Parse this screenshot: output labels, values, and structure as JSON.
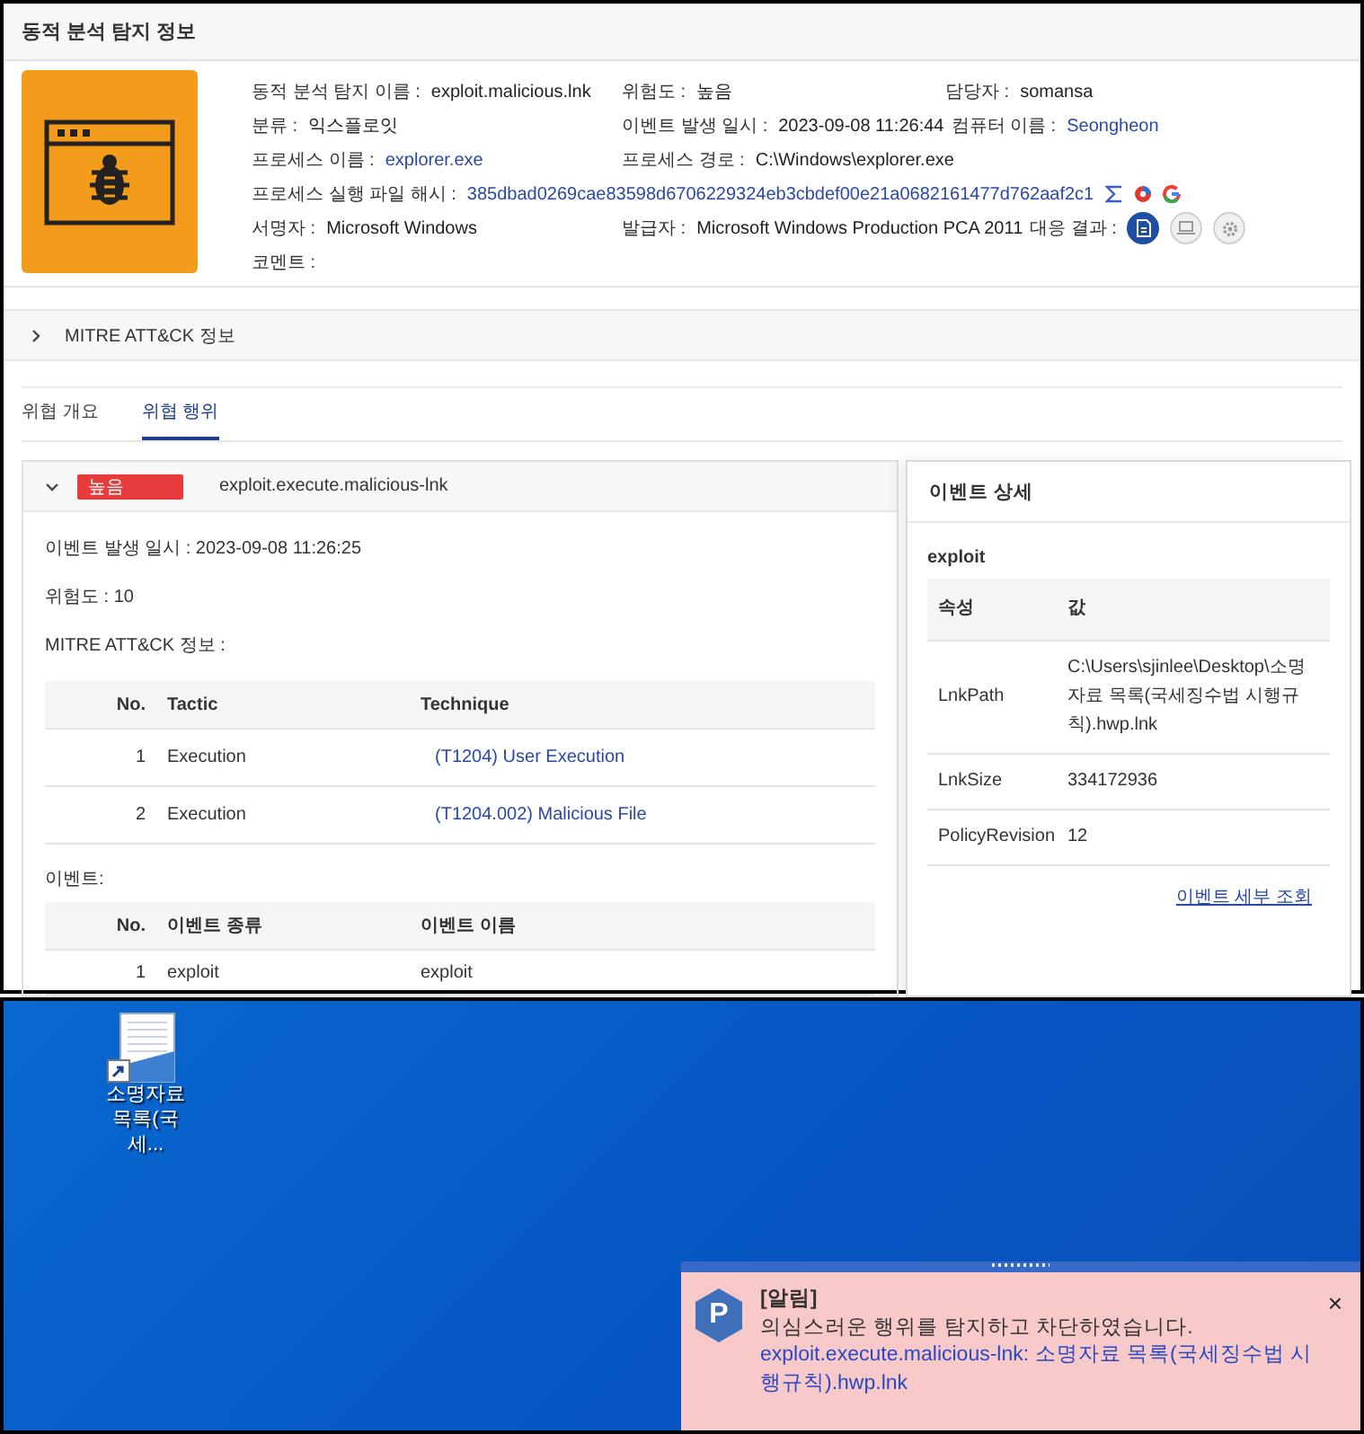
{
  "header": {
    "title": "동적 분석 탐지 정보"
  },
  "summary": {
    "rows": [
      [
        {
          "label": "동적 분석 탐지 이름 :",
          "value": "exploit.malicious.lnk",
          "kind": "text"
        },
        {
          "label": "위험도 :",
          "value": "높음",
          "kind": "text"
        },
        {
          "label": "담당자 :",
          "value": "somansa",
          "kind": "text"
        }
      ],
      [
        {
          "label": "분류 :",
          "value": "익스플로잇",
          "kind": "text"
        },
        {
          "label": "이벤트 발생 일시 :",
          "value": "2023-09-08 11:26:44",
          "kind": "text"
        },
        {
          "label": "컴퓨터 이름 :",
          "value": "Seongheon",
          "kind": "link"
        }
      ],
      [
        {
          "label": "프로세스 이름 :",
          "value": "explorer.exe",
          "kind": "link"
        },
        {
          "label": "프로세스 경로 :",
          "value": "C:\\Windows\\explorer.exe",
          "kind": "text"
        }
      ],
      [
        {
          "label": "프로세스 실행 파일 해시 :",
          "value": "385dbad0269cae83598d6706229324eb3cbdef00e21a0682161477d762aaf2c1",
          "kind": "hash"
        }
      ],
      [
        {
          "label": "서명자 :",
          "value": "Microsoft Windows",
          "kind": "text"
        },
        {
          "label": "발급자 :",
          "value": "Microsoft Windows Production PCA 2011",
          "kind": "text"
        },
        {
          "label": "대응 결과 :",
          "kind": "response",
          "actions": [
            {
              "active": true
            },
            {
              "active": false
            },
            {
              "active": false
            }
          ]
        }
      ],
      [
        {
          "label": "코멘트 :",
          "kind": "text"
        }
      ]
    ]
  },
  "mitre_section": {
    "title": "MITRE ATT&CK 정보",
    "expanded": false
  },
  "tabs": [
    {
      "label": "위협 개요",
      "selected": false
    },
    {
      "label": "위협 행위",
      "selected": true
    }
  ],
  "behavior": {
    "expanded": true,
    "severity": "높음",
    "title": "exploit.execute.malicious-lnk",
    "lines": [
      "이벤트 발생 일시 : 2023-09-08 11:26:25",
      "위험도 : 10",
      "MITRE ATT&CK 정보 :"
    ],
    "mitre_table": {
      "columns": [
        "No.",
        "Tactic",
        "Technique"
      ],
      "rows": [
        [
          "1",
          "Execution",
          "(T1204) User Execution"
        ],
        [
          "2",
          "Execution",
          "(T1204.002) Malicious File"
        ]
      ]
    },
    "events_label": "이벤트:",
    "events_table": {
      "columns": [
        "No.",
        "이벤트 종류",
        "이벤트 이름"
      ],
      "rows": [
        [
          "1",
          "exploit",
          "exploit"
        ]
      ]
    }
  },
  "event_detail": {
    "title": "이벤트 상세",
    "section": "exploit",
    "columns": [
      "속성",
      "값"
    ],
    "rows": [
      [
        "LnkPath",
        "C:\\Users\\sjinlee\\Desktop\\소명자료 목록(국세징수법 시행규칙).hwp.lnk"
      ],
      [
        "LnkSize",
        "334172936"
      ],
      [
        "PolicyRevision",
        "12"
      ]
    ],
    "link": "이벤트 세부 조회"
  },
  "desktop": {
    "icon_label": "소명자료 목록(국세..."
  },
  "toast": {
    "logo_letter": "P",
    "title": "[알림]",
    "message": "의심스러운 행위를 탐지하고 차단하였습니다.",
    "detail": "exploit.execute.malicious-lnk: 소명자료 목록(국세징수법 시행규칙).hwp.lnk",
    "close": "×"
  }
}
